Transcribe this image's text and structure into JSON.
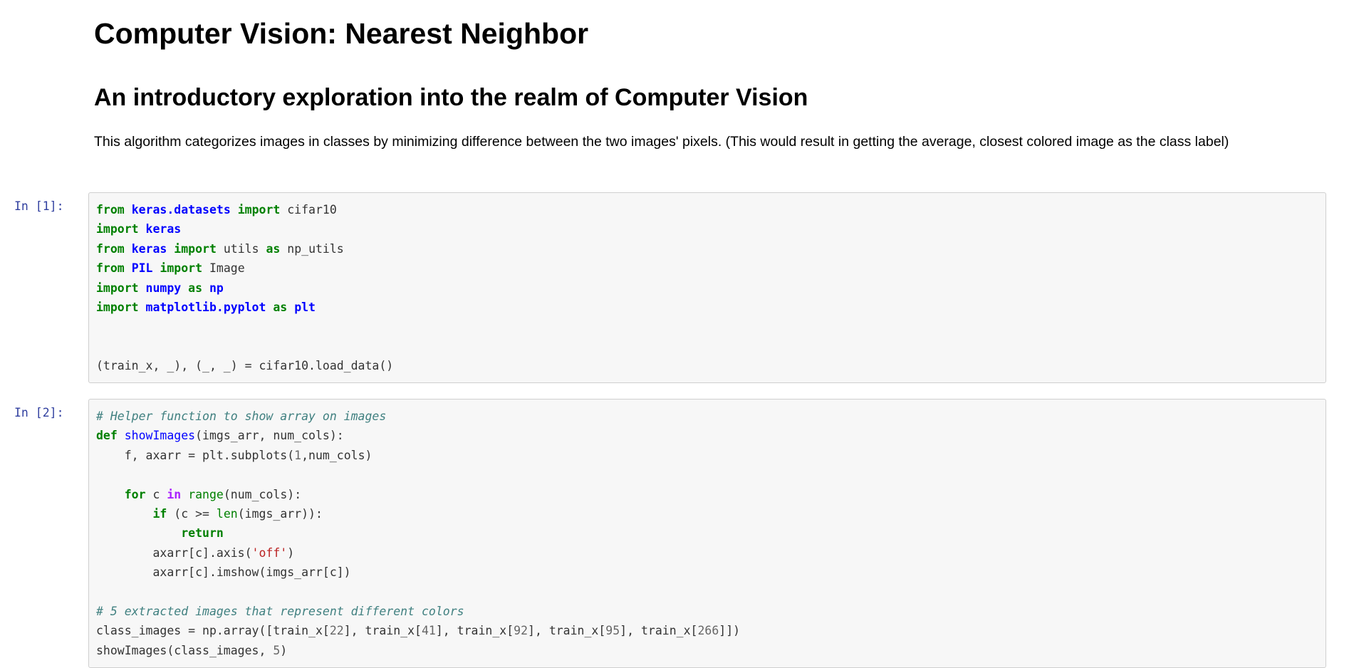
{
  "title": "Computer Vision: Nearest Neighbor",
  "subtitle": "An introductory exploration into the realm of Computer Vision",
  "description": "This algorithm categorizes images in classes by minimizing difference between the two images' pixels. (This would result in getting the average, closest colored image as the class label)",
  "cells": [
    {
      "prompt": "In [1]:",
      "lines": [
        [
          [
            "kw",
            "from"
          ],
          [
            "t",
            " "
          ],
          [
            "nm",
            "keras.datasets"
          ],
          [
            "t",
            " "
          ],
          [
            "kw",
            "import"
          ],
          [
            "t",
            " cifar10"
          ]
        ],
        [
          [
            "kw",
            "import"
          ],
          [
            "t",
            " "
          ],
          [
            "nm",
            "keras"
          ]
        ],
        [
          [
            "kw",
            "from"
          ],
          [
            "t",
            " "
          ],
          [
            "nm",
            "keras"
          ],
          [
            "t",
            " "
          ],
          [
            "kw",
            "import"
          ],
          [
            "t",
            " utils "
          ],
          [
            "kw",
            "as"
          ],
          [
            "t",
            " np_utils"
          ]
        ],
        [
          [
            "kw",
            "from"
          ],
          [
            "t",
            " "
          ],
          [
            "nm",
            "PIL"
          ],
          [
            "t",
            " "
          ],
          [
            "kw",
            "import"
          ],
          [
            "t",
            " Image"
          ]
        ],
        [
          [
            "kw",
            "import"
          ],
          [
            "t",
            " "
          ],
          [
            "nm",
            "numpy"
          ],
          [
            "t",
            " "
          ],
          [
            "kw",
            "as"
          ],
          [
            "t",
            " "
          ],
          [
            "nm",
            "np"
          ]
        ],
        [
          [
            "kw",
            "import"
          ],
          [
            "t",
            " "
          ],
          [
            "nm",
            "matplotlib.pyplot"
          ],
          [
            "t",
            " "
          ],
          [
            "kw",
            "as"
          ],
          [
            "t",
            " "
          ],
          [
            "nm",
            "plt"
          ]
        ],
        [],
        [],
        [
          [
            "t",
            "(train_x, _), (_, _) = cifar10.load_data()"
          ]
        ]
      ]
    },
    {
      "prompt": "In [2]:",
      "lines": [
        [
          [
            "cm",
            "# Helper function to show array on images"
          ]
        ],
        [
          [
            "kw",
            "def"
          ],
          [
            "t",
            " "
          ],
          [
            "fn",
            "showImages"
          ],
          [
            "t",
            "(imgs_arr, num_cols):"
          ]
        ],
        [
          [
            "t",
            "    f, axarr = plt.subplots("
          ],
          [
            "nu",
            "1"
          ],
          [
            "t",
            ",num_cols)"
          ]
        ],
        [],
        [
          [
            "t",
            "    "
          ],
          [
            "kw",
            "for"
          ],
          [
            "t",
            " c "
          ],
          [
            "ow",
            "in"
          ],
          [
            "t",
            " "
          ],
          [
            "bi",
            "range"
          ],
          [
            "t",
            "(num_cols):"
          ]
        ],
        [
          [
            "t",
            "        "
          ],
          [
            "kw",
            "if"
          ],
          [
            "t",
            " (c >= "
          ],
          [
            "bi",
            "len"
          ],
          [
            "t",
            "(imgs_arr)):"
          ]
        ],
        [
          [
            "t",
            "            "
          ],
          [
            "kw",
            "return"
          ]
        ],
        [
          [
            "t",
            "        axarr[c].axis("
          ],
          [
            "st",
            "'off'"
          ],
          [
            "t",
            ")"
          ]
        ],
        [
          [
            "t",
            "        axarr[c].imshow(imgs_arr[c])"
          ]
        ],
        [],
        [
          [
            "cm",
            "# 5 extracted images that represent different colors"
          ]
        ],
        [
          [
            "t",
            "class_images = np.array([train_x["
          ],
          [
            "nu",
            "22"
          ],
          [
            "t",
            "], train_x["
          ],
          [
            "nu",
            "41"
          ],
          [
            "t",
            "], train_x["
          ],
          [
            "nu",
            "92"
          ],
          [
            "t",
            "], train_x["
          ],
          [
            "nu",
            "95"
          ],
          [
            "t",
            "], train_x["
          ],
          [
            "nu",
            "266"
          ],
          [
            "t",
            "]])"
          ]
        ],
        [
          [
            "t",
            "showImages(class_images, "
          ],
          [
            "nu",
            "5"
          ],
          [
            "t",
            ")"
          ]
        ]
      ]
    }
  ]
}
